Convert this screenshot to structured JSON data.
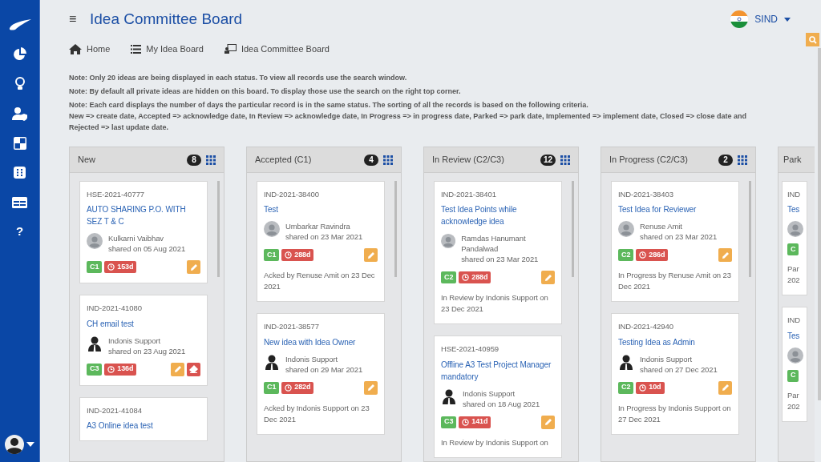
{
  "sidebar": {
    "items": [
      {
        "kind": "logo"
      },
      {
        "kind": "pie"
      },
      {
        "kind": "bulb"
      },
      {
        "kind": "user-shield"
      },
      {
        "kind": "squares"
      },
      {
        "kind": "grid"
      },
      {
        "kind": "table"
      },
      {
        "kind": "help",
        "label": "?"
      }
    ]
  },
  "header": {
    "menu_icon": "≡",
    "title": "Idea Committee Board",
    "user": "SIND"
  },
  "nav": [
    {
      "kind": "home",
      "label": "Home"
    },
    {
      "kind": "list",
      "label": "My Idea Board"
    },
    {
      "kind": "board",
      "label": "Idea Committee Board"
    }
  ],
  "notes": [
    "Note: Only 20 ideas are being displayed in each status. To view all records use the search window.",
    "Note: By default all private ideas are hidden on this board. To display those use the search on the right top corner.",
    "Note: Each card displays the number of days the particular record is in the same status. The sorting of all the records is based on the following criteria.\nNew => create date, Accepted => acknowledge date, In Review => acknowledge date, In Progress => in progress date, Parked => park date, Implemented => implement date, Closed => close date and\nRejected => last update date."
  ],
  "columns": [
    {
      "title": "New",
      "count": "8",
      "cards": [
        {
          "id": "HSE-2021-40777",
          "title": "AUTO SHARING P.O. WITH SEZ T & C",
          "avatar": {
            "kind": "placeholder"
          },
          "author": "Kulkarni Vaibhav",
          "shared": "shared on 05 Aug 2021",
          "class": "C1",
          "days": "153d",
          "actions": [
            {
              "kind": "edit"
            }
          ]
        },
        {
          "id": "IND-2021-41080",
          "title": "CH email test",
          "avatar": {
            "kind": "person"
          },
          "author": "Indonis Support",
          "shared": "shared on 23 Aug 2021",
          "class": "C3",
          "days": "136d",
          "actions": [
            {
              "kind": "edit"
            },
            {
              "kind": "erase"
            }
          ]
        },
        {
          "id": "IND-2021-41084",
          "title": "A3 Online idea test"
        }
      ]
    },
    {
      "title": "Accepted (C1)",
      "count": "4",
      "cards": [
        {
          "id": "IND-2021-38400",
          "title": "Test",
          "avatar": {
            "kind": "placeholder"
          },
          "author": "Umbarkar Ravindra",
          "shared": "shared on 23 Mar 2021",
          "class": "C1",
          "days": "288d",
          "actions": [
            {
              "kind": "edit"
            }
          ],
          "footer": "Acked by Renuse Amit on 23 Dec 2021"
        },
        {
          "id": "IND-2021-38577",
          "title": "New idea with Idea Owner",
          "avatar": {
            "kind": "person"
          },
          "author": "Indonis Support",
          "shared": "shared on 29 Mar 2021",
          "class": "C1",
          "days": "282d",
          "actions": [
            {
              "kind": "edit"
            }
          ],
          "footer": "Acked by Indonis Support on 23 Dec 2021"
        }
      ]
    },
    {
      "title": "In Review (C2/C3)",
      "count": "12",
      "cards": [
        {
          "id": "IND-2021-38401",
          "title": "Test Idea Points while acknowledge idea",
          "avatar": {
            "kind": "placeholder"
          },
          "author": "Ramdas Hanumant Pandalwad",
          "shared": "shared on 23 Mar 2021",
          "class": "C2",
          "days": "288d",
          "actions": [
            {
              "kind": "edit"
            }
          ],
          "footer": "In Review by Indonis Support on 23 Dec 2021"
        },
        {
          "id": "HSE-2021-40959",
          "title": "Offline A3 Test Project Manager mandatory",
          "avatar": {
            "kind": "person"
          },
          "author": "Indonis Support",
          "shared": "shared on 18 Aug 2021",
          "class": "C3",
          "days": "141d",
          "actions": [
            {
              "kind": "edit"
            }
          ],
          "footer": "In Review by Indonis Support on"
        }
      ]
    },
    {
      "title": "In Progress (C2/C3)",
      "count": "2",
      "cards": [
        {
          "id": "IND-2021-38403",
          "title": "Test Idea for Reviewer",
          "avatar": {
            "kind": "placeholder"
          },
          "author": "Renuse Amit",
          "shared": "shared on 23 Mar 2021",
          "class": "C2",
          "days": "286d",
          "actions": [
            {
              "kind": "edit"
            }
          ],
          "footer": "In Progress by Renuse Amit on 23 Dec 2021"
        },
        {
          "id": "IND-2021-42940",
          "title": "Testing Idea as Admin",
          "avatar": {
            "kind": "person"
          },
          "author": "Indonis Support",
          "shared": "shared on 27 Dec 2021",
          "class": "C2",
          "days": "10d",
          "actions": [
            {
              "kind": "edit"
            }
          ],
          "footer": "In Progress by Indonis Support on 27 Dec 2021"
        }
      ]
    },
    {
      "title": "Park",
      "cards": [
        {
          "id": "IND",
          "title": "Tes",
          "avatar": {
            "kind": "placeholder"
          },
          "class": "C",
          "footer": "Par\n202"
        },
        {
          "id": "IND",
          "title": "Tes",
          "avatar": {
            "kind": "placeholder"
          },
          "class": "C",
          "footer": "Par\n202"
        }
      ]
    }
  ]
}
